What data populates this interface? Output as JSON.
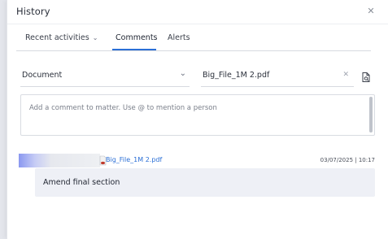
{
  "panel": {
    "title": "History"
  },
  "tabs": [
    {
      "label": "Recent activities",
      "has_dropdown": true
    },
    {
      "label": "Comments",
      "active": true
    },
    {
      "label": "Alerts"
    }
  ],
  "filters": {
    "type_select": {
      "value": "Document"
    },
    "file_field": {
      "value": "Big_File_1M 2.pdf"
    }
  },
  "comment_input": {
    "placeholder": "Add a comment to matter. Use @ to mention a person"
  },
  "comments": [
    {
      "attachment": "Big_File_1M 2.pdf",
      "timestamp": "03/07/2025 | 10:17",
      "text": "Amend final section"
    }
  ],
  "colors": {
    "accent": "#2b6fd6",
    "bubble": "#eef0f6"
  }
}
